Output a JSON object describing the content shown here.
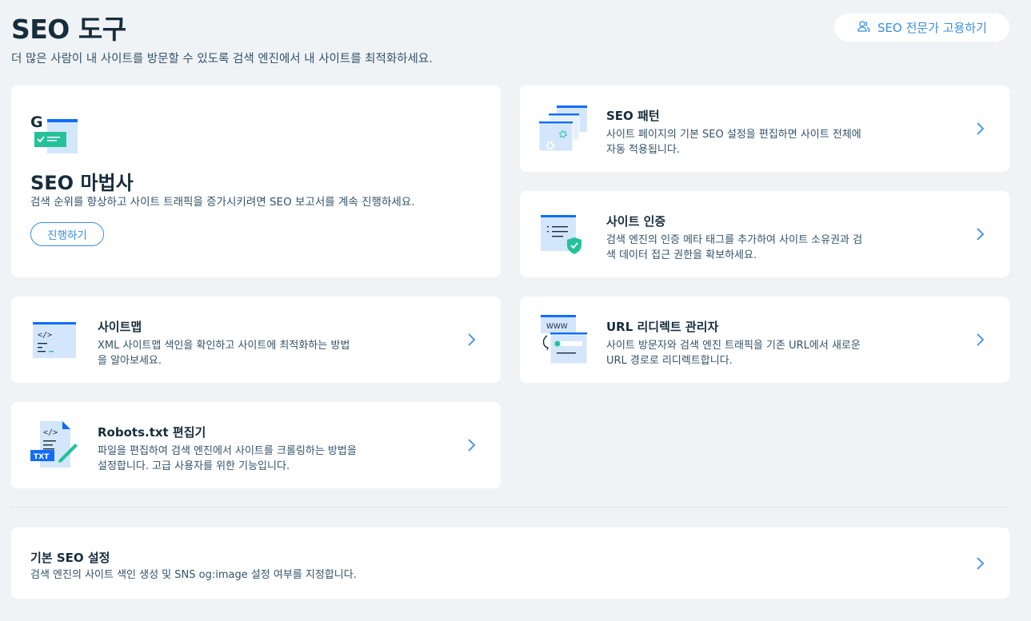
{
  "header": {
    "title": "SEO 도구",
    "subtitle": "더 많은 사람이 내 사이트를 방문할 수 있도록 검색 엔진에서 내 사이트를 최적화하세요.",
    "hire_button": "SEO 전문가 고용하기"
  },
  "wizard": {
    "title": "SEO 마법사",
    "description": "검색 순위를 향상하고 사이트 트래픽을 증가시키려면 SEO 보고서를 계속 진행하세요.",
    "button": "진행하기",
    "icon_letter": "G"
  },
  "patterns": {
    "title": "SEO 패턴",
    "line1": "사이트 페이지의 기본 SEO 설정을 편집하면 사이트 전체에",
    "line2": "자동 적용됩니다."
  },
  "verification": {
    "title": "사이트 인증",
    "line1": "검색 엔진의 인증 메타 태그를 추가하여 사이트 소유권과 검",
    "line2": "색 데이터 접근 권한을 확보하세요."
  },
  "sitemap": {
    "title": "사이트맵",
    "line1": "XML 사이트맵 색인을 확인하고 사이트에 최적화하는 방법",
    "line2": "을 알아보세요.",
    "code_glyph": "</>"
  },
  "redirect": {
    "title": "URL 리디렉트 관리자",
    "line1": "사이트 방문자와 검색 엔진 트래픽을 기존 URL에서 새로운",
    "line2": "URL 경로로 리디렉트합니다.",
    "www_label": "WWW"
  },
  "robots": {
    "title": "Robots.txt 편집기",
    "line1": "파일을 편집하여 검색 엔진에서 사이트를 크롤링하는 방법을",
    "line2": "설정합니다. 고급 사용자를 위한 기능입니다.",
    "code_glyph": "</>",
    "badge": "TXT"
  },
  "basic": {
    "title": "기본 SEO 설정",
    "description": "검색 엔진의 사이트 색인 생성 및 SNS og:image 설정 여부를 지정합니다."
  },
  "colors": {
    "accent": "#3b8ee6",
    "background": "#f0f3f6",
    "illus_light": "#d3e6fb",
    "illus_blue": "#116dff",
    "check_green": "#25c29a"
  }
}
